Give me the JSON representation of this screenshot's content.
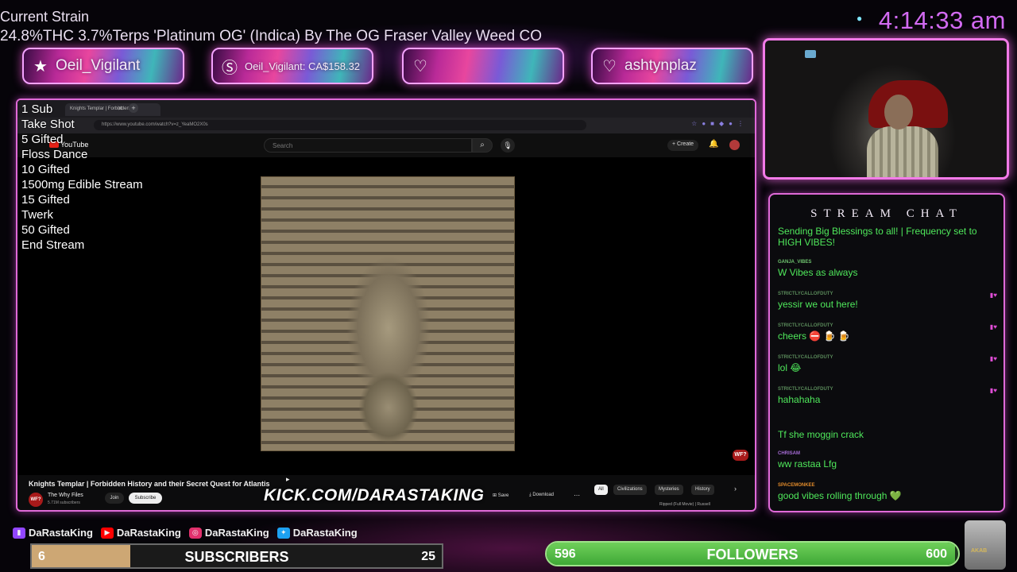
{
  "strain": {
    "title": "Current Strain",
    "description": "24.8%THC 3.7%Terps 'Platinum OG' (Indica) By The OG Fraser Valley Weed CO"
  },
  "clock": "4:14:33 am",
  "banners": [
    {
      "icon": "star-icon",
      "text": "Oeil_Vigilant"
    },
    {
      "icon": "dollar-icon",
      "text": "Oeil_Vigilant: CA$158.32"
    },
    {
      "icon": "heart-icon",
      "text": ""
    },
    {
      "icon": "heart-icon",
      "text": "ashtynplaz"
    }
  ],
  "goals": [
    "1 Sub",
    "Take Shot",
    "5 Gifted",
    "Floss Dance",
    "10 Gifted",
    "1500mg Edible Stream",
    "15 Gifted",
    "Twerk",
    "50 Gifted",
    "End Stream"
  ],
  "browser": {
    "tab_title": "Knights Templar | Forbidden",
    "url": "https://www.youtube.com/watch?v=z_YeaMO2X0s"
  },
  "youtube": {
    "logo": "YouTube",
    "search_placeholder": "Search",
    "create_label": "Create",
    "video_title": "Knights Templar | Forbidden History and their Secret Quest for Atlantis",
    "channel_avatar": "WF?",
    "channel_name": "The Why Files",
    "channel_subs": "5.71M subscribers",
    "join_label": "Join",
    "subscribe_label": "Subscribe",
    "save_label": "Save",
    "download_label": "Download",
    "badge": "WF?",
    "chips": [
      "All",
      "Civilizations",
      "Mysteries",
      "History"
    ],
    "related_title": "Ripped (Full Movie) | Russell"
  },
  "kick_url": "KICK.COM/DARASTAKING",
  "chat": {
    "title": "STREAM CHAT",
    "messages": [
      {
        "user": "",
        "text": "Sending Big Blessings to all! | Frequency set to HIGH VIBES!",
        "user_color": "#6fc46f",
        "badges": ""
      },
      {
        "user": "GANJA_VIBES",
        "text": "W Vibes as always",
        "user_color": "#6fc46f",
        "badges": ""
      },
      {
        "user": "STRICTLYCALLOFDUTY",
        "text": "yessir we out here!",
        "user_color": "#5a8a5a",
        "badges": "▮♥"
      },
      {
        "user": "STRICTLYCALLOFDUTY",
        "text": "cheers ⛔ 🍺 🍺",
        "user_color": "#5a8a5a",
        "badges": "▮♥"
      },
      {
        "user": "STRICTLYCALLOFDUTY",
        "text": "lol 😂",
        "user_color": "#5a8a5a",
        "badges": "▮♥"
      },
      {
        "user": "STRICTLYCALLOFDUTY",
        "text": "hahahaha",
        "user_color": "#5a8a5a",
        "badges": "▮♥"
      },
      {
        "user": "",
        "text": "Tf she moggin crack",
        "user_color": "#c0392b",
        "badges": ""
      },
      {
        "user": "CHRISAM",
        "text": "ww rastaa Lfg",
        "user_color": "#a66bd6",
        "badges": ""
      },
      {
        "user": "SPACEMONKEE",
        "text": "good vibes rolling through 💚",
        "user_color": "#e08a2a",
        "badges": ""
      }
    ]
  },
  "socials": [
    {
      "icon": "twitch-icon",
      "color": "#9146ff",
      "name": "DaRastaKing"
    },
    {
      "icon": "youtube-icon",
      "color": "#ff0000",
      "name": "DaRastaKing"
    },
    {
      "icon": "instagram-icon",
      "color": "#e1306c",
      "name": "DaRastaKing"
    },
    {
      "icon": "twitter-icon",
      "color": "#1da1f2",
      "name": "DaRastaKing"
    }
  ],
  "subscribers": {
    "current": "6",
    "label": "SUBSCRIBERS",
    "goal": "25",
    "progress": 0.24
  },
  "followers": {
    "current": "596",
    "label": "FOLLOWERS",
    "goal": "600",
    "progress": 0.993
  },
  "cup_label": "AKAB"
}
